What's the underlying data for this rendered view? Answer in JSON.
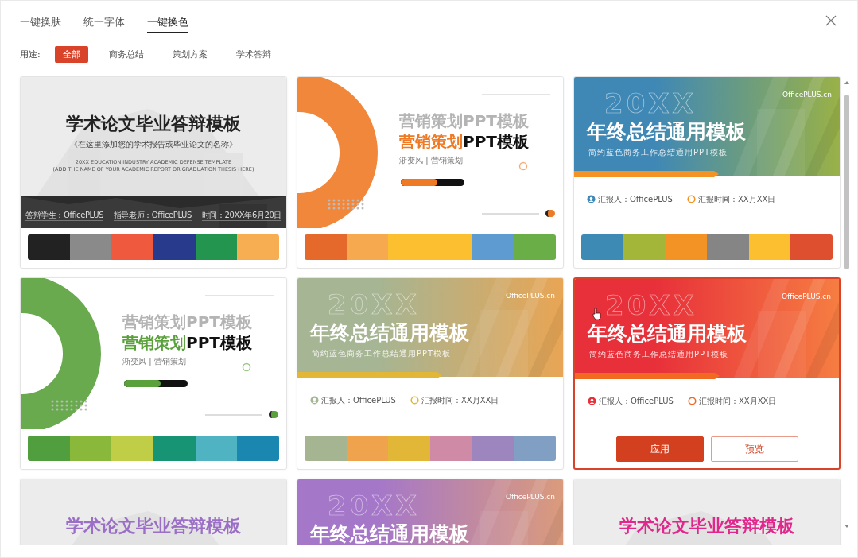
{
  "tabs": [
    {
      "label": "一键换肤",
      "selected": false
    },
    {
      "label": "统一字体",
      "selected": false
    },
    {
      "label": "一键换色",
      "selected": true
    }
  ],
  "filter": {
    "label": "用途:",
    "options": [
      {
        "label": "全部",
        "selected": true
      },
      {
        "label": "商务总结",
        "selected": false
      },
      {
        "label": "策划方案",
        "selected": false
      },
      {
        "label": "学术答辩",
        "selected": false
      }
    ]
  },
  "cards": [
    {
      "kind": "thesis",
      "selected": false,
      "color": "#222222",
      "title": "学术论文毕业答辩模板",
      "subtitle": "《在这里添加您的学术报告或毕业论文的名称》",
      "english": [
        "20XX EDUCATION INDUSTRY ACADEMIC DEFENSE TEMPLATE",
        "(ADD THE NAME OF YOUR ACADEMIC REPORT OR GRADUATION THESIS HERE)"
      ],
      "info": [
        "答辩学生：OfficePLUS",
        "指导老师：OfficePLUS",
        "时间：20XX年6月20日"
      ],
      "palette": [
        {
          "color": "#222222"
        },
        {
          "color": "#8a8a8a"
        },
        {
          "color": "#ef5a3e"
        },
        {
          "color": "#273a8c"
        },
        {
          "color": "#23954e"
        },
        {
          "color": "#f7ae52"
        }
      ]
    },
    {
      "kind": "marketing",
      "selected": false,
      "color": "#ee7a26",
      "ghost_title": "营销策划PPT模板",
      "title": {
        "accent": "营销策划",
        "rest": "PPT模板"
      },
      "subtitle": "渐变风 | 营销策划",
      "palette": [
        {
          "color": "#e5692a"
        },
        {
          "color": "#f6a94e"
        },
        {
          "color": "#fcbf2f"
        },
        {
          "color": "#fcbf2f"
        },
        {
          "color": "#5e9bd0"
        },
        {
          "color": "#6aae48"
        }
      ]
    },
    {
      "kind": "summary",
      "selected": false,
      "color": "#3f88b6",
      "brand": "OfficePLUS.cn",
      "ghost": "20XX",
      "title": "年终总结通用模板",
      "subtitle": "简约蓝色商务工作总结通用PPT模板",
      "reporter": "汇报人：OfficePLUS",
      "time": "汇报时间：XX月XX日",
      "palette": [
        {
          "color": "#3d8ab5"
        },
        {
          "color": "#a4b63a"
        },
        {
          "color": "#f39325"
        },
        {
          "color": "#858585"
        },
        {
          "color": "#fcbf2f"
        },
        {
          "color": "#dd4f2e"
        }
      ]
    },
    {
      "kind": "marketing",
      "selected": false,
      "color": "#5aa13c",
      "ghost_title": "营销策划PPT模板",
      "title": {
        "accent": "营销策划",
        "rest": "PPT模板"
      },
      "subtitle": "渐变风 | 营销策划",
      "palette": [
        {
          "color": "#519e3e"
        },
        {
          "color": "#8ab83a"
        },
        {
          "color": "#bfcd47"
        },
        {
          "color": "#169474"
        },
        {
          "color": "#50b3c2"
        },
        {
          "color": "#1a87b0"
        }
      ]
    },
    {
      "kind": "summary",
      "selected": false,
      "color": "#a6b593",
      "brand": "OfficePLUS.cn",
      "ghost": "20XX",
      "title": "年终总结通用模板",
      "subtitle": "简约蓝色商务工作总结通用PPT模板",
      "reporter": "汇报人：OfficePLUS",
      "time": "汇报时间：XX月XX日",
      "palette": [
        {
          "color": "#a5b592"
        },
        {
          "color": "#f0a34d"
        },
        {
          "color": "#e2b737"
        },
        {
          "color": "#cf8aa5"
        },
        {
          "color": "#9d85bd"
        },
        {
          "color": "#809fc3"
        }
      ]
    },
    {
      "kind": "summary",
      "selected": true,
      "color": "#e8303a",
      "brand": "OfficePLUS.cn",
      "ghost": "20XX",
      "title": "年终总结通用模板",
      "subtitle": "简约蓝色商务工作总结通用PPT模板",
      "reporter": "汇报人：OfficePLUS",
      "time": "汇报时间：XX月XX日",
      "actions": [
        {
          "label": "应用",
          "kind": "primary"
        },
        {
          "label": "预览",
          "kind": "secondary"
        }
      ]
    },
    {
      "kind": "thesis",
      "selected": false,
      "color": "#9b6fc6",
      "title": "学术论文毕业答辩模板"
    },
    {
      "kind": "summary",
      "selected": false,
      "color": "#a577c9",
      "brand": "OfficePLUS.cn",
      "ghost": "20XX",
      "title": "年终总结通用模板"
    },
    {
      "kind": "thesis",
      "selected": false,
      "color": "#e0278c",
      "title": "学术论文毕业答辩模板"
    }
  ]
}
